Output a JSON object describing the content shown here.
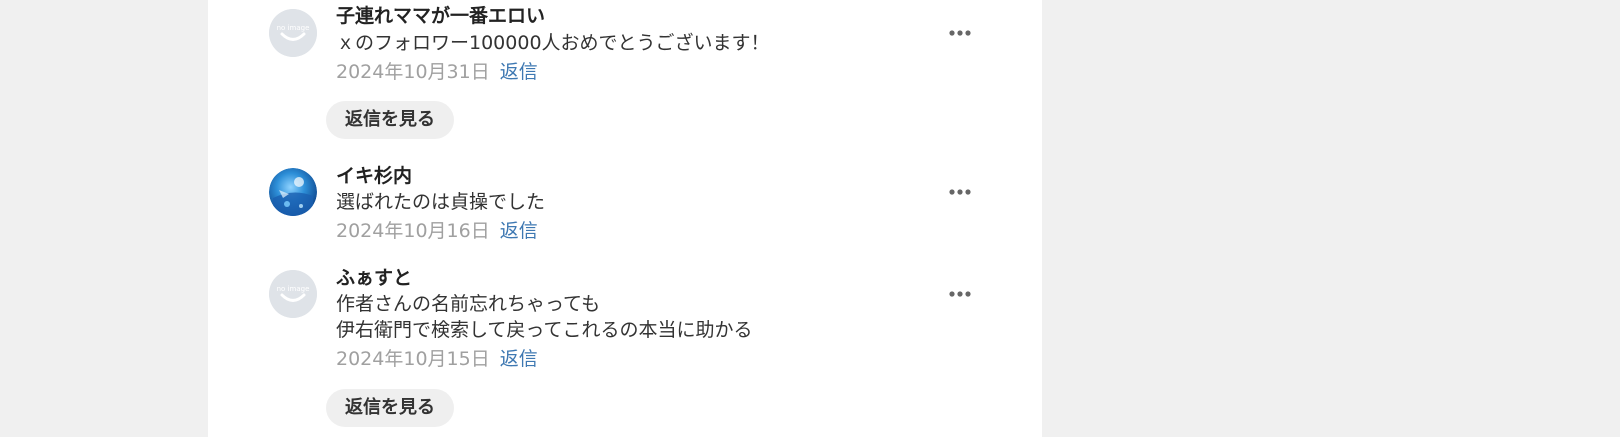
{
  "comments": [
    {
      "avatar": "no-image-avatar",
      "name": "子連れママが一番エロい",
      "lines": [
        "ｘのフォロワー100000人おめでとうございます！"
      ],
      "date": "2024年10月31日",
      "reply_label": "返信",
      "more_icon": "more-horizontal-icon",
      "view_replies_label": "返信を見る"
    },
    {
      "avatar": "photo-avatar",
      "name": "イキ杉内",
      "lines": [
        "選ばれたのは貞操でした"
      ],
      "date": "2024年10月16日",
      "reply_label": "返信",
      "more_icon": "more-horizontal-icon"
    },
    {
      "avatar": "no-image-avatar",
      "name": "ふぁすと",
      "lines": [
        "作者さんの名前忘れちゃっても",
        "伊右衛門で検索して戻ってこれるの本当に助かる"
      ],
      "date": "2024年10月15日",
      "reply_label": "返信",
      "more_icon": "more-horizontal-icon",
      "view_replies_label": "返信を見る"
    }
  ],
  "colors": {
    "page_background": "#f0f0f0",
    "panel_background": "#ffffff",
    "date_text": "#a0a0a0",
    "reply_link": "#3e78b2",
    "view_replies_background": "#efefef"
  }
}
